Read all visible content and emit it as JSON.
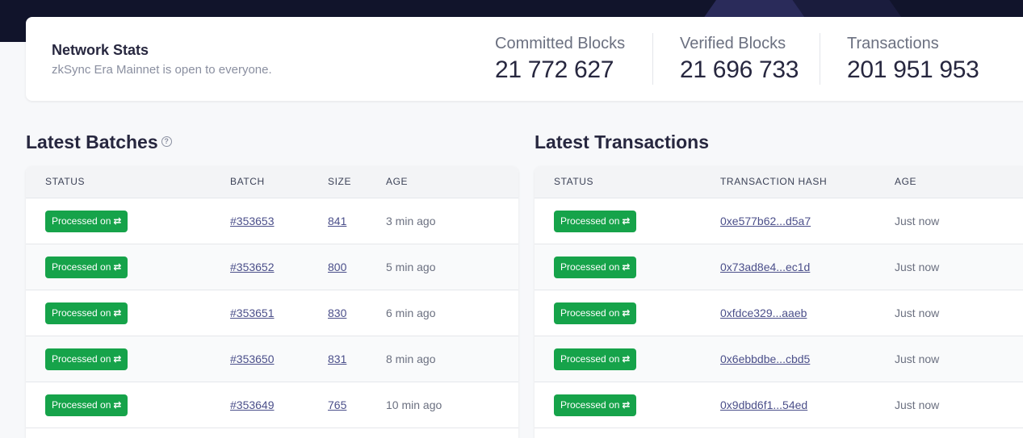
{
  "network_stats": {
    "title": "Network Stats",
    "subtitle": "zkSync Era Mainnet is open to everyone.",
    "committed_label": "Committed Blocks",
    "committed_value": "21 772 627",
    "verified_label": "Verified Blocks",
    "verified_value": "21 696 733",
    "transactions_label": "Transactions",
    "transactions_value": "201 951 953"
  },
  "batches": {
    "title": "Latest Batches",
    "help_icon": "?",
    "columns": [
      "STATUS",
      "BATCH",
      "SIZE",
      "AGE"
    ],
    "rows": [
      {
        "status": "Processed on",
        "batch": "#353653",
        "size": "841",
        "age": "3 min ago"
      },
      {
        "status": "Processed on",
        "batch": "#353652",
        "size": "800",
        "age": "5 min ago"
      },
      {
        "status": "Processed on",
        "batch": "#353651",
        "size": "830",
        "age": "6 min ago"
      },
      {
        "status": "Processed on",
        "batch": "#353650",
        "size": "831",
        "age": "8 min ago"
      },
      {
        "status": "Processed on",
        "batch": "#353649",
        "size": "765",
        "age": "10 min ago"
      }
    ]
  },
  "transactions": {
    "title": "Latest Transactions",
    "columns": [
      "STATUS",
      "TRANSACTION HASH",
      "AGE"
    ],
    "rows": [
      {
        "status": "Processed on",
        "hash": "0xe577b62...d5a7",
        "age": "Just now"
      },
      {
        "status": "Processed on",
        "hash": "0x73ad8e4...ec1d",
        "age": "Just now"
      },
      {
        "status": "Processed on",
        "hash": "0xfdce329...aaeb",
        "age": "Just now"
      },
      {
        "status": "Processed on",
        "hash": "0x6ebbdbe...cbd5",
        "age": "Just now"
      },
      {
        "status": "Processed on",
        "hash": "0x9dbd6f1...54ed",
        "age": "Just now"
      }
    ]
  },
  "icons": {
    "badge_arrows": "⇄"
  },
  "colors": {
    "status_green": "#16a34a",
    "link": "#4b4f8a",
    "header_band": "#11142b"
  }
}
